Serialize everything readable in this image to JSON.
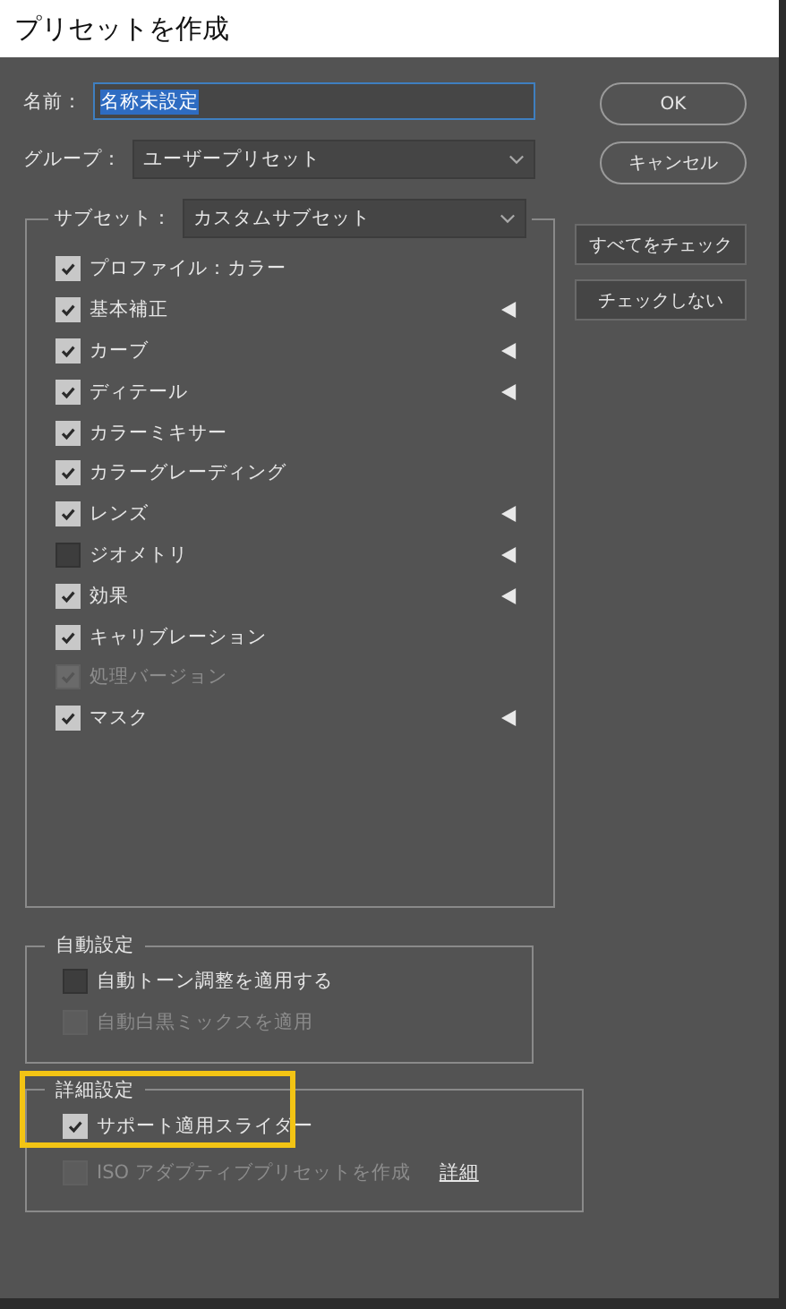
{
  "window": {
    "title": "プリセットを作成"
  },
  "name_field": {
    "label": "名前：",
    "value": "名称未設定",
    "selected": true
  },
  "group_field": {
    "label": "グループ：",
    "value": "ユーザープリセット"
  },
  "buttons": {
    "ok": "OK",
    "cancel": "キャンセル",
    "check_all": "すべてをチェック",
    "check_none": "チェックしない"
  },
  "subset": {
    "label": "サブセット：",
    "value": "カスタムサブセット",
    "items": [
      {
        "label": "プロファイル：カラー",
        "checked": true,
        "disabled": false,
        "expandable": false
      },
      {
        "label": "基本補正",
        "checked": true,
        "disabled": false,
        "expandable": true
      },
      {
        "label": "カーブ",
        "checked": true,
        "disabled": false,
        "expandable": true
      },
      {
        "label": "ディテール",
        "checked": true,
        "disabled": false,
        "expandable": true
      },
      {
        "label": "カラーミキサー",
        "checked": true,
        "disabled": false,
        "expandable": false
      },
      {
        "label": "カラーグレーディング",
        "checked": true,
        "disabled": false,
        "expandable": false
      },
      {
        "label": "レンズ",
        "checked": true,
        "disabled": false,
        "expandable": true
      },
      {
        "label": "ジオメトリ",
        "checked": false,
        "disabled": false,
        "expandable": true
      },
      {
        "label": "効果",
        "checked": true,
        "disabled": false,
        "expandable": true
      },
      {
        "label": "キャリブレーション",
        "checked": true,
        "disabled": false,
        "expandable": false
      },
      {
        "label": "処理バージョン",
        "checked": true,
        "disabled": true,
        "expandable": false
      },
      {
        "label": "マスク",
        "checked": true,
        "disabled": false,
        "expandable": true
      }
    ]
  },
  "auto_settings": {
    "title": "自動設定",
    "options": [
      {
        "label": "自動トーン調整を適用する",
        "checked": false,
        "disabled": false
      },
      {
        "label": "自動白黒ミックスを適用",
        "checked": false,
        "disabled": true
      }
    ]
  },
  "advanced_settings": {
    "title": "詳細設定",
    "highlighted": true,
    "options": [
      {
        "label": "サポート適用スライダー",
        "checked": true,
        "disabled": false
      },
      {
        "label": "ISO アダプティブプリセットを作成",
        "checked": false,
        "disabled": true,
        "link": "詳細"
      }
    ]
  }
}
